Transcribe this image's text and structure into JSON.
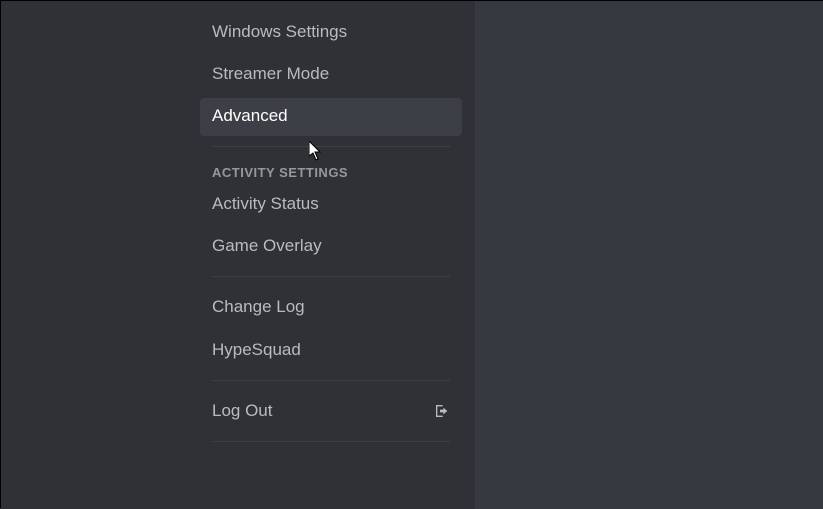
{
  "sidebar": {
    "items": [
      {
        "label": "Windows Settings"
      },
      {
        "label": "Streamer Mode"
      },
      {
        "label": "Advanced"
      }
    ],
    "section_header": "Activity Settings",
    "activity_items": [
      {
        "label": "Activity Status"
      },
      {
        "label": "Game Overlay"
      }
    ],
    "footer_items": [
      {
        "label": "Change Log"
      },
      {
        "label": "HypeSquad"
      }
    ],
    "logout_label": "Log Out"
  }
}
